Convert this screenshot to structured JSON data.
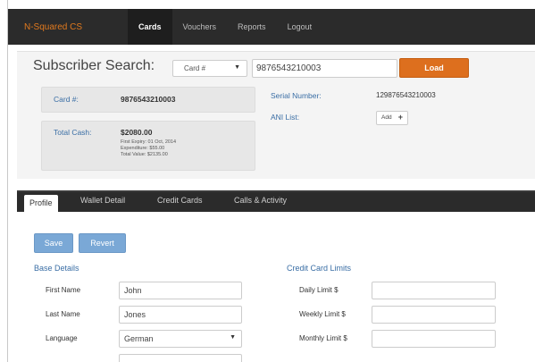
{
  "nav": {
    "brand": "N-Squared CS",
    "items": [
      "Cards",
      "Vouchers",
      "Reports",
      "Logout"
    ]
  },
  "subscriber": {
    "title": "Subscriber Search:",
    "search_type": "Card #",
    "search_value": "9876543210003",
    "load_label": "Load",
    "card_label": "Card #:",
    "card_value": "9876543210003",
    "total_cash_label": "Total Cash:",
    "total_cash_value": "$2080.00",
    "first_expiry": "First Expiry: 01 Oct, 2014",
    "expenditure": "Expenditure: $55.00",
    "total_value": "Total Value: $2135.00",
    "serial_label": "Serial Number:",
    "serial_value": "129876543210003",
    "ani_label": "ANI List:",
    "add_label": "Add"
  },
  "tabs": [
    "Profile",
    "Wallet Detail",
    "Credit Cards",
    "Calls & Activity"
  ],
  "profile": {
    "save_label": "Save",
    "revert_label": "Revert",
    "base_details_title": "Base Details",
    "credit_limits_title": "Credit Card Limits",
    "first_name_label": "First Name",
    "first_name_value": "John",
    "last_name_label": "Last Name",
    "last_name_value": "Jones",
    "language_label": "Language",
    "language_value": "German",
    "daily_limit_label": "Daily Limit $",
    "weekly_limit_label": "Weekly Limit $",
    "monthly_limit_label": "Monthly Limit $"
  },
  "colors": {
    "accent": "#dd6f1e",
    "navbar": "#2b2b2b",
    "link": "#3a6ea5",
    "button_blue": "#7aa8d6"
  }
}
